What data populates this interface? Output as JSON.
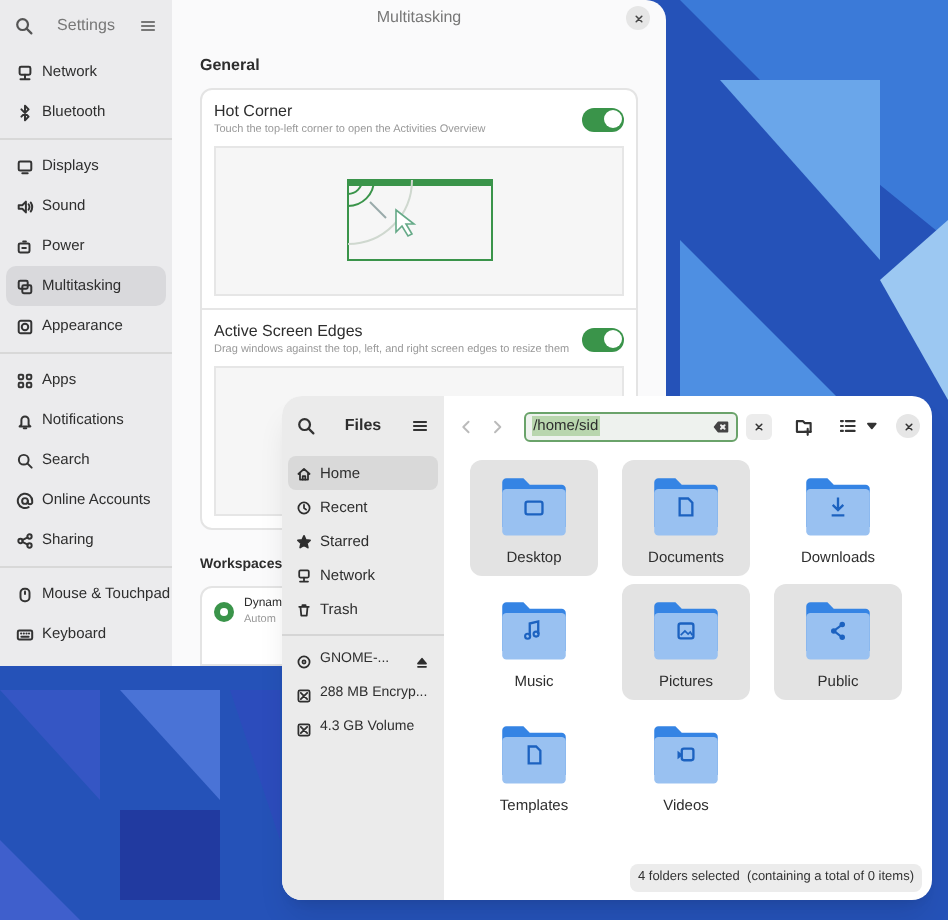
{
  "settings": {
    "title": "Settings",
    "sidebar_groups": [
      [
        {
          "label": "Network",
          "kind": "network",
          "selected": false
        },
        {
          "label": "Bluetooth",
          "kind": "bluetooth",
          "selected": false
        }
      ],
      [
        {
          "label": "Displays",
          "kind": "display",
          "selected": false
        },
        {
          "label": "Sound",
          "kind": "sound",
          "selected": false
        },
        {
          "label": "Power",
          "kind": "power",
          "selected": false
        },
        {
          "label": "Multitasking",
          "kind": "multitasking",
          "selected": true
        },
        {
          "label": "Appearance",
          "kind": "appearance",
          "selected": false
        }
      ],
      [
        {
          "label": "Apps",
          "kind": "apps",
          "selected": false
        },
        {
          "label": "Notifications",
          "kind": "bell",
          "selected": false
        },
        {
          "label": "Search",
          "kind": "search",
          "selected": false
        },
        {
          "label": "Online Accounts",
          "kind": "at",
          "selected": false
        },
        {
          "label": "Sharing",
          "kind": "share",
          "selected": false
        }
      ],
      [
        {
          "label": "Mouse & Touchpad",
          "kind": "mouse",
          "selected": false
        },
        {
          "label": "Keyboard",
          "kind": "keyboard",
          "selected": false
        }
      ]
    ],
    "page_title": "Multitasking",
    "general": {
      "heading": "General",
      "rows": [
        {
          "title": "Hot Corner",
          "description": "Touch the top-left corner to open the Activities Overview",
          "on": true
        },
        {
          "title": "Active Screen Edges",
          "description": "Drag windows against the top, left, and right screen edges to resize them",
          "on": true
        }
      ]
    },
    "workspaces": {
      "heading": "Workspaces",
      "options": [
        {
          "title": "Dynam",
          "description": "Autom",
          "selected": true
        }
      ]
    }
  },
  "files": {
    "title": "Files",
    "path": "/home/sid",
    "places": [
      {
        "label": "Home",
        "kind": "home",
        "selected": true
      },
      {
        "label": "Recent",
        "kind": "clock",
        "selected": false
      },
      {
        "label": "Starred",
        "kind": "star",
        "selected": false
      },
      {
        "label": "Network",
        "kind": "network",
        "selected": false
      },
      {
        "label": "Trash",
        "kind": "trash",
        "selected": false
      }
    ],
    "devices": [
      {
        "label": "GNOME-...",
        "kind": "disc",
        "ejectable": true
      },
      {
        "label": "288 MB Encryp...",
        "kind": "drive",
        "ejectable": false
      },
      {
        "label": "4.3 GB Volume",
        "kind": "drive",
        "ejectable": false
      }
    ],
    "folders": [
      {
        "name": "Desktop",
        "kind": "plain",
        "selected": true
      },
      {
        "name": "Documents",
        "kind": "document",
        "selected": true
      },
      {
        "name": "Downloads",
        "kind": "download",
        "selected": false
      },
      {
        "name": "Music",
        "kind": "music",
        "selected": false
      },
      {
        "name": "Pictures",
        "kind": "picture",
        "selected": true
      },
      {
        "name": "Public",
        "kind": "share",
        "selected": true
      },
      {
        "name": "Templates",
        "kind": "template",
        "selected": false
      },
      {
        "name": "Videos",
        "kind": "video",
        "selected": false
      }
    ],
    "status": "4 folders selected  (containing a total of 0 items)"
  }
}
